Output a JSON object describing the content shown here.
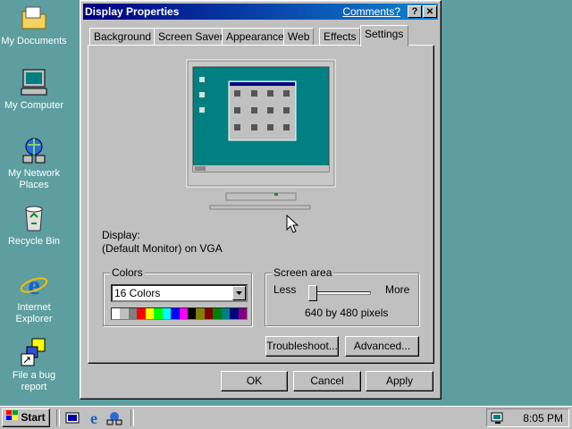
{
  "desktop": {
    "icons": [
      {
        "label": "My Documents"
      },
      {
        "label": "My Computer"
      },
      {
        "label": "My Network Places"
      },
      {
        "label": "Recycle Bin"
      },
      {
        "label": "Internet Explorer"
      },
      {
        "label": "File a bug report"
      }
    ]
  },
  "dialog": {
    "title": "Display Properties",
    "help_link": "Comments?",
    "help_button": "?",
    "close_button": "✕",
    "tabs": [
      {
        "label": "Background"
      },
      {
        "label": "Screen Saver"
      },
      {
        "label": "Appearance"
      },
      {
        "label": "Web"
      },
      {
        "label": "Effects"
      },
      {
        "label": "Settings"
      }
    ],
    "display_label": "Display:",
    "display_value": "(Default Monitor) on VGA",
    "colors": {
      "group_label": "Colors",
      "selected": "16 Colors",
      "palette": [
        "#ffffff",
        "#c0c0c0",
        "#808080",
        "#ff0000",
        "#ffff00",
        "#00ff00",
        "#00ffff",
        "#0000ff",
        "#ff00ff",
        "#000000",
        "#808000",
        "#800000",
        "#008000",
        "#008080",
        "#000080",
        "#800080"
      ]
    },
    "screen_area": {
      "group_label": "Screen area",
      "less_label": "Less",
      "more_label": "More",
      "resolution": "640 by 480 pixels",
      "slider_level": 0
    },
    "troubleshoot_button": "Troubleshoot...",
    "advanced_button": "Advanced...",
    "ok_button": "OK",
    "cancel_button": "Cancel",
    "apply_button": "Apply"
  },
  "taskbar": {
    "start_label": "Start",
    "clock": "8:05 PM"
  }
}
